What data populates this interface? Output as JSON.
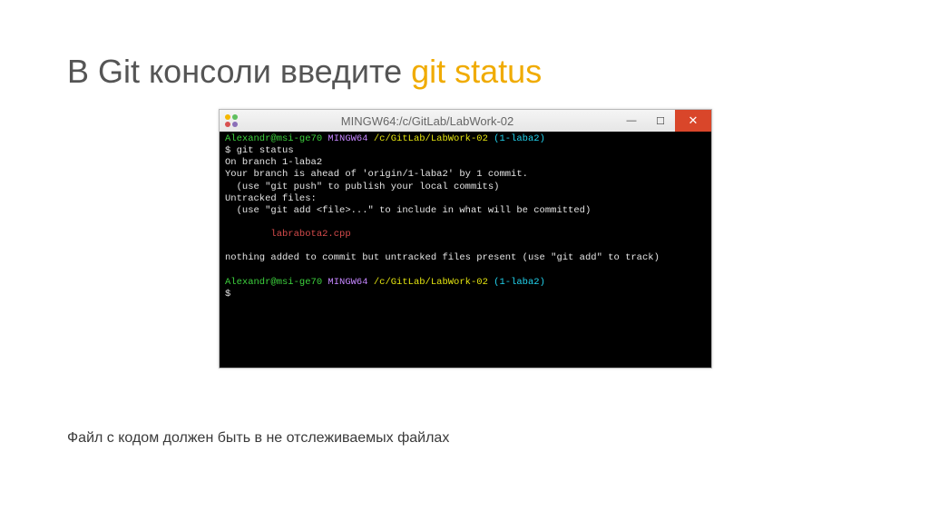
{
  "heading": {
    "prefix": "В Git консоли введите ",
    "highlight": "git status"
  },
  "window": {
    "title": "MINGW64:/c/GitLab/LabWork-02"
  },
  "terminal": {
    "prompt1_user": "Alexandr@msi-ge70 ",
    "prompt1_sys": "MINGW64 ",
    "prompt1_path": "/c/GitLab/LabWork-02 ",
    "prompt1_branch": "(1-laba2)",
    "cmd_prefix": "$ ",
    "cmd": "git status",
    "l1": "On branch 1-laba2",
    "l2": "Your branch is ahead of 'origin/1-laba2' by 1 commit.",
    "l3": "  (use \"git push\" to publish your local commits)",
    "l4": "Untracked files:",
    "l5": "  (use \"git add <file>...\" to include in what will be committed)",
    "untracked": "        labrabota2.cpp",
    "l6": "nothing added to commit but untracked files present (use \"git add\" to track)",
    "prompt2_user": "Alexandr@msi-ge70 ",
    "prompt2_sys": "MINGW64 ",
    "prompt2_path": "/c/GitLab/LabWork-02 ",
    "prompt2_branch": "(1-laba2)",
    "dollar": "$"
  },
  "footer": "Файл с кодом должен быть в не отслеживаемых файлах",
  "controls": {
    "min": "—",
    "max": "☐",
    "close": "✕"
  }
}
